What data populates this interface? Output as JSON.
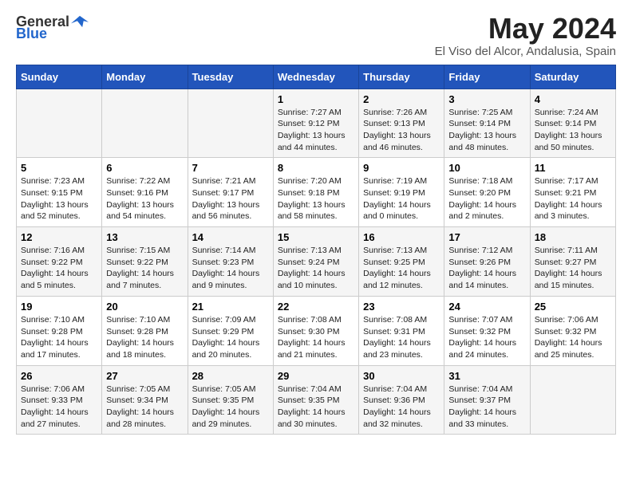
{
  "header": {
    "logo_general": "General",
    "logo_blue": "Blue",
    "title": "May 2024",
    "subtitle": "El Viso del Alcor, Andalusia, Spain"
  },
  "days_of_week": [
    "Sunday",
    "Monday",
    "Tuesday",
    "Wednesday",
    "Thursday",
    "Friday",
    "Saturday"
  ],
  "weeks": [
    [
      {
        "day": "",
        "info": ""
      },
      {
        "day": "",
        "info": ""
      },
      {
        "day": "",
        "info": ""
      },
      {
        "day": "1",
        "info": "Sunrise: 7:27 AM\nSunset: 9:12 PM\nDaylight: 13 hours and 44 minutes."
      },
      {
        "day": "2",
        "info": "Sunrise: 7:26 AM\nSunset: 9:13 PM\nDaylight: 13 hours and 46 minutes."
      },
      {
        "day": "3",
        "info": "Sunrise: 7:25 AM\nSunset: 9:14 PM\nDaylight: 13 hours and 48 minutes."
      },
      {
        "day": "4",
        "info": "Sunrise: 7:24 AM\nSunset: 9:14 PM\nDaylight: 13 hours and 50 minutes."
      }
    ],
    [
      {
        "day": "5",
        "info": "Sunrise: 7:23 AM\nSunset: 9:15 PM\nDaylight: 13 hours and 52 minutes."
      },
      {
        "day": "6",
        "info": "Sunrise: 7:22 AM\nSunset: 9:16 PM\nDaylight: 13 hours and 54 minutes."
      },
      {
        "day": "7",
        "info": "Sunrise: 7:21 AM\nSunset: 9:17 PM\nDaylight: 13 hours and 56 minutes."
      },
      {
        "day": "8",
        "info": "Sunrise: 7:20 AM\nSunset: 9:18 PM\nDaylight: 13 hours and 58 minutes."
      },
      {
        "day": "9",
        "info": "Sunrise: 7:19 AM\nSunset: 9:19 PM\nDaylight: 14 hours and 0 minutes."
      },
      {
        "day": "10",
        "info": "Sunrise: 7:18 AM\nSunset: 9:20 PM\nDaylight: 14 hours and 2 minutes."
      },
      {
        "day": "11",
        "info": "Sunrise: 7:17 AM\nSunset: 9:21 PM\nDaylight: 14 hours and 3 minutes."
      }
    ],
    [
      {
        "day": "12",
        "info": "Sunrise: 7:16 AM\nSunset: 9:22 PM\nDaylight: 14 hours and 5 minutes."
      },
      {
        "day": "13",
        "info": "Sunrise: 7:15 AM\nSunset: 9:22 PM\nDaylight: 14 hours and 7 minutes."
      },
      {
        "day": "14",
        "info": "Sunrise: 7:14 AM\nSunset: 9:23 PM\nDaylight: 14 hours and 9 minutes."
      },
      {
        "day": "15",
        "info": "Sunrise: 7:13 AM\nSunset: 9:24 PM\nDaylight: 14 hours and 10 minutes."
      },
      {
        "day": "16",
        "info": "Sunrise: 7:13 AM\nSunset: 9:25 PM\nDaylight: 14 hours and 12 minutes."
      },
      {
        "day": "17",
        "info": "Sunrise: 7:12 AM\nSunset: 9:26 PM\nDaylight: 14 hours and 14 minutes."
      },
      {
        "day": "18",
        "info": "Sunrise: 7:11 AM\nSunset: 9:27 PM\nDaylight: 14 hours and 15 minutes."
      }
    ],
    [
      {
        "day": "19",
        "info": "Sunrise: 7:10 AM\nSunset: 9:28 PM\nDaylight: 14 hours and 17 minutes."
      },
      {
        "day": "20",
        "info": "Sunrise: 7:10 AM\nSunset: 9:28 PM\nDaylight: 14 hours and 18 minutes."
      },
      {
        "day": "21",
        "info": "Sunrise: 7:09 AM\nSunset: 9:29 PM\nDaylight: 14 hours and 20 minutes."
      },
      {
        "day": "22",
        "info": "Sunrise: 7:08 AM\nSunset: 9:30 PM\nDaylight: 14 hours and 21 minutes."
      },
      {
        "day": "23",
        "info": "Sunrise: 7:08 AM\nSunset: 9:31 PM\nDaylight: 14 hours and 23 minutes."
      },
      {
        "day": "24",
        "info": "Sunrise: 7:07 AM\nSunset: 9:32 PM\nDaylight: 14 hours and 24 minutes."
      },
      {
        "day": "25",
        "info": "Sunrise: 7:06 AM\nSunset: 9:32 PM\nDaylight: 14 hours and 25 minutes."
      }
    ],
    [
      {
        "day": "26",
        "info": "Sunrise: 7:06 AM\nSunset: 9:33 PM\nDaylight: 14 hours and 27 minutes."
      },
      {
        "day": "27",
        "info": "Sunrise: 7:05 AM\nSunset: 9:34 PM\nDaylight: 14 hours and 28 minutes."
      },
      {
        "day": "28",
        "info": "Sunrise: 7:05 AM\nSunset: 9:35 PM\nDaylight: 14 hours and 29 minutes."
      },
      {
        "day": "29",
        "info": "Sunrise: 7:04 AM\nSunset: 9:35 PM\nDaylight: 14 hours and 30 minutes."
      },
      {
        "day": "30",
        "info": "Sunrise: 7:04 AM\nSunset: 9:36 PM\nDaylight: 14 hours and 32 minutes."
      },
      {
        "day": "31",
        "info": "Sunrise: 7:04 AM\nSunset: 9:37 PM\nDaylight: 14 hours and 33 minutes."
      },
      {
        "day": "",
        "info": ""
      }
    ]
  ]
}
